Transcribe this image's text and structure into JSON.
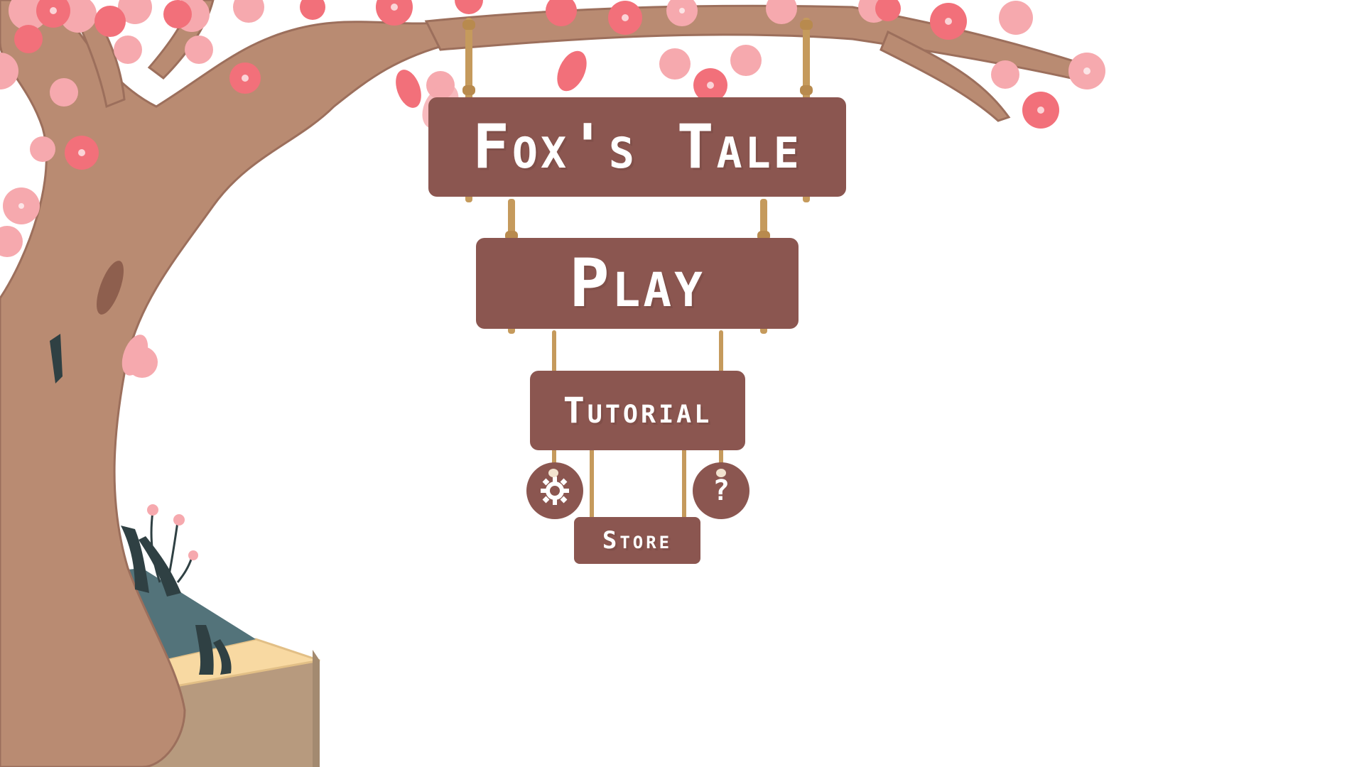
{
  "menu": {
    "title": "Fox's Tale",
    "play_label": "Play",
    "tutorial_label": "Tutorial",
    "store_label": "Store",
    "help_glyph": "?"
  },
  "icons": {
    "settings": "gear-icon",
    "help": "question-mark-icon"
  },
  "colors": {
    "sign_wood": "#8b5650",
    "rope": "#c59a5c",
    "bark": "#b98b72",
    "blossom": "#f2707a",
    "blossom_light": "#f6a9ae",
    "pot_rim": "#f8d9a2",
    "pot_body": "#b79a7e",
    "soil": "#53737a"
  }
}
